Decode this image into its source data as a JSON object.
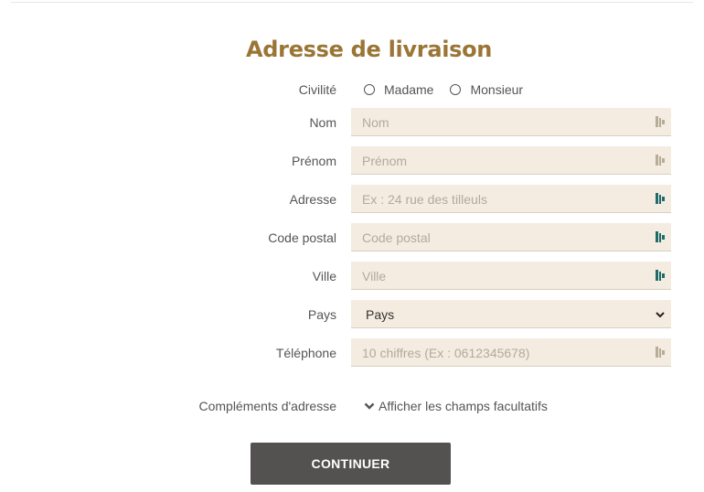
{
  "form": {
    "title": "Adresse de livraison",
    "civility": {
      "label": "Civilité",
      "options": [
        "Madame",
        "Monsieur"
      ]
    },
    "fields": {
      "nom": {
        "label": "Nom",
        "placeholder": "Nom",
        "value": ""
      },
      "prenom": {
        "label": "Prénom",
        "placeholder": "Prénom",
        "value": ""
      },
      "adresse": {
        "label": "Adresse",
        "placeholder": "Ex : 24 rue des tilleuls",
        "value": ""
      },
      "code_postal": {
        "label": "Code postal",
        "placeholder": "Code postal",
        "value": ""
      },
      "ville": {
        "label": "Ville",
        "placeholder": "Ville",
        "value": ""
      },
      "pays": {
        "label": "Pays",
        "selected": "Pays"
      },
      "telephone": {
        "label": "Téléphone",
        "placeholder": "10 chiffres (Ex : 0612345678)",
        "value": ""
      }
    },
    "complements": {
      "label": "Compléments d'adresse",
      "toggle_label": "Afficher les champs facultatifs"
    },
    "submit_label": "CONTINUER"
  },
  "icons": {
    "field_icon": "autofill-key-icon",
    "field_icon_color_inactive": "#b8ab98",
    "field_icon_color_active": "#1e6b6a",
    "chevron": "chevron-down-icon"
  },
  "colors": {
    "title": "#9a7535",
    "field_background": "#f4ece0",
    "button_background": "#545151"
  }
}
